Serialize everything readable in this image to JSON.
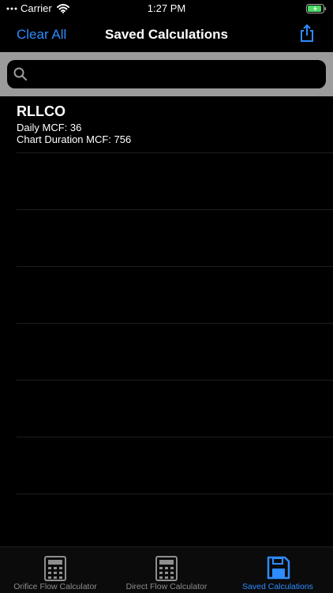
{
  "status_bar": {
    "carrier": "Carrier",
    "time": "1:27 PM"
  },
  "nav": {
    "clear_label": "Clear All",
    "title": "Saved Calculations"
  },
  "search": {
    "placeholder": ""
  },
  "saved": [
    {
      "name": "RLLCO",
      "daily": "Daily MCF: 36",
      "duration": "Chart Duration MCF: 756"
    }
  ],
  "tabs": [
    {
      "label": "Orifice Flow Calculator",
      "icon": "calculator-icon"
    },
    {
      "label": "Direct Flow Calculator",
      "icon": "calculator-icon"
    },
    {
      "label": "Saved Calculations",
      "icon": "floppy-disk-icon"
    }
  ],
  "colors": {
    "accent": "#2d8cff",
    "search_bar_bg": "#9b9b9b",
    "battery": "#4cd964",
    "inactive": "#8e8e8e"
  }
}
